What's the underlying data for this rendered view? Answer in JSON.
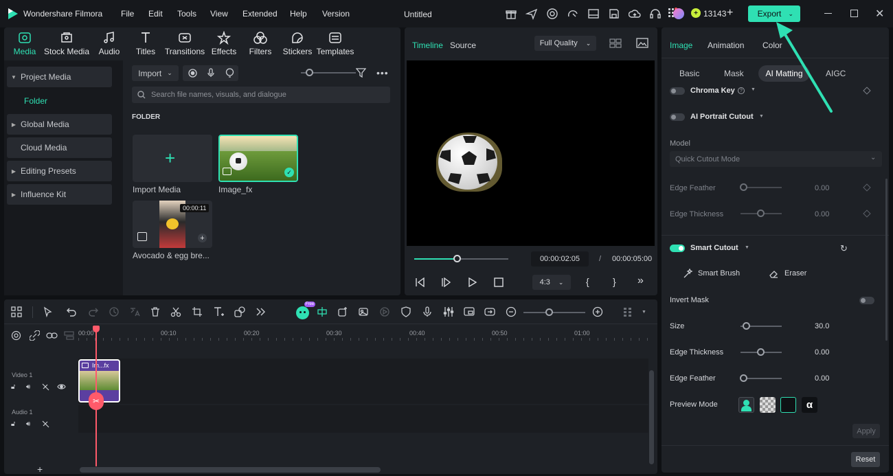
{
  "app": {
    "name": "Wondershare Filmora",
    "project_title": "Untitled",
    "credits": "13143",
    "export_label": "Export"
  },
  "menu": [
    "File",
    "Edit",
    "Tools",
    "View",
    "Extended",
    "Help",
    "Version"
  ],
  "media_toolbar": [
    "Media",
    "Stock Media",
    "Audio",
    "Titles",
    "Transitions",
    "Effects",
    "Filters",
    "Stickers",
    "Templates"
  ],
  "sidebar": {
    "project_media": "Project Media",
    "folder": "Folder",
    "items": [
      "Global Media",
      "Cloud Media",
      "Editing Presets",
      "Influence Kit"
    ]
  },
  "library": {
    "import_label": "Import",
    "search_placeholder": "Search file names, visuals, and dialogue",
    "section": "FOLDER",
    "import_media": "Import Media",
    "image_fx": "Image_fx",
    "avocado": "Avocado & egg bre...",
    "avocado_duration": "00:00:11"
  },
  "preview": {
    "tab_timeline": "Timeline",
    "tab_source": "Source",
    "quality": "Full Quality",
    "current_time": "00:00:02:05",
    "separator": "/",
    "total_time": "00:00:05:00",
    "aspect": "4:3",
    "progress": 0.45
  },
  "right_panel": {
    "tabs": [
      "Image",
      "Animation",
      "Color"
    ],
    "subtabs": [
      "Basic",
      "Mask",
      "AI Matting",
      "AIGC"
    ],
    "chroma_key": "Chroma Key",
    "portrait_cutout": "AI Portrait Cutout",
    "model_label": "Model",
    "model_value": "Quick Cutout Mode",
    "edge_feather_1": {
      "label": "Edge Feather",
      "value": "0.00"
    },
    "edge_thickness_1": {
      "label": "Edge Thickness",
      "value": "0.00"
    },
    "smart_cutout": "Smart Cutout",
    "smart_brush": "Smart Brush",
    "eraser": "Eraser",
    "invert_mask": "Invert Mask",
    "size": {
      "label": "Size",
      "value": "30.0"
    },
    "edge_thickness_2": {
      "label": "Edge Thickness",
      "value": "0.00"
    },
    "edge_feather_2": {
      "label": "Edge Feather",
      "value": "0.00"
    },
    "preview_mode": "Preview Mode",
    "apply": "Apply",
    "reset": "Reset"
  },
  "timeline": {
    "ruler": [
      "00:00",
      "00:10",
      "00:20",
      "00:30",
      "00:40",
      "00:50",
      "01:00"
    ],
    "video_track": "Video 1",
    "audio_track": "Audio 1",
    "clip_label": "Im...fx",
    "free_badge": "Free"
  },
  "colors": {
    "accent": "#2fe0b3",
    "playhead": "#ff5a6a",
    "clip": "#5b3fa0"
  }
}
